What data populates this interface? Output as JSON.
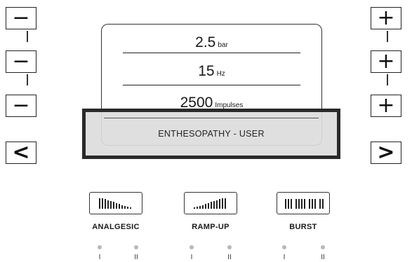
{
  "left_controls": {
    "minus_glyph": "−",
    "left_arrow_glyph": "<"
  },
  "right_controls": {
    "plus_glyph": "+",
    "right_arrow_glyph": ">"
  },
  "display": {
    "pressure_value": "2.5",
    "pressure_unit": "bar",
    "frequency_value": "15",
    "frequency_unit": "Hz",
    "impulses_value": "2500",
    "impulses_unit": "Impulses"
  },
  "program": {
    "label": "ENTHESOPATHY - USER"
  },
  "modes": [
    {
      "label": "ANALGESIC",
      "icon": "descending-bars-icon",
      "level_1": "I",
      "level_2": "II"
    },
    {
      "label": "RAMP-UP",
      "icon": "ascending-bars-icon",
      "level_1": "I",
      "level_2": "II"
    },
    {
      "label": "BURST",
      "icon": "grouped-bars-icon",
      "level_1": "I",
      "level_2": "II"
    }
  ],
  "colors": {
    "frame": "#222222",
    "highlight_box": "#2a2a2a",
    "highlight_fill": "#dcdcdc",
    "indicator_dot": "#b8b8b8"
  }
}
